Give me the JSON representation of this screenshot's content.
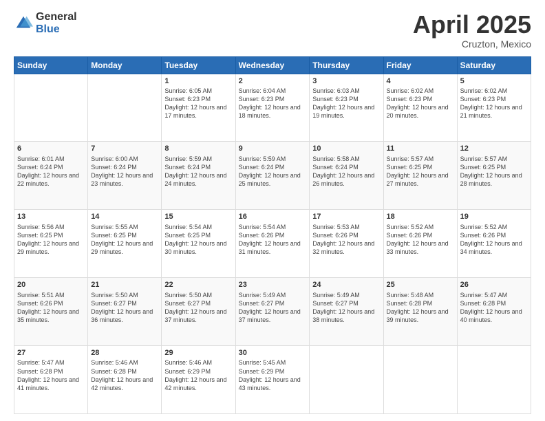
{
  "header": {
    "logo_general": "General",
    "logo_blue": "Blue",
    "title": "April 2025",
    "location": "Cruzton, Mexico"
  },
  "weekdays": [
    "Sunday",
    "Monday",
    "Tuesday",
    "Wednesday",
    "Thursday",
    "Friday",
    "Saturday"
  ],
  "weeks": [
    [
      {
        "day": "",
        "info": ""
      },
      {
        "day": "",
        "info": ""
      },
      {
        "day": "1",
        "info": "Sunrise: 6:05 AM\nSunset: 6:23 PM\nDaylight: 12 hours and 17 minutes."
      },
      {
        "day": "2",
        "info": "Sunrise: 6:04 AM\nSunset: 6:23 PM\nDaylight: 12 hours and 18 minutes."
      },
      {
        "day": "3",
        "info": "Sunrise: 6:03 AM\nSunset: 6:23 PM\nDaylight: 12 hours and 19 minutes."
      },
      {
        "day": "4",
        "info": "Sunrise: 6:02 AM\nSunset: 6:23 PM\nDaylight: 12 hours and 20 minutes."
      },
      {
        "day": "5",
        "info": "Sunrise: 6:02 AM\nSunset: 6:23 PM\nDaylight: 12 hours and 21 minutes."
      }
    ],
    [
      {
        "day": "6",
        "info": "Sunrise: 6:01 AM\nSunset: 6:24 PM\nDaylight: 12 hours and 22 minutes."
      },
      {
        "day": "7",
        "info": "Sunrise: 6:00 AM\nSunset: 6:24 PM\nDaylight: 12 hours and 23 minutes."
      },
      {
        "day": "8",
        "info": "Sunrise: 5:59 AM\nSunset: 6:24 PM\nDaylight: 12 hours and 24 minutes."
      },
      {
        "day": "9",
        "info": "Sunrise: 5:59 AM\nSunset: 6:24 PM\nDaylight: 12 hours and 25 minutes."
      },
      {
        "day": "10",
        "info": "Sunrise: 5:58 AM\nSunset: 6:24 PM\nDaylight: 12 hours and 26 minutes."
      },
      {
        "day": "11",
        "info": "Sunrise: 5:57 AM\nSunset: 6:25 PM\nDaylight: 12 hours and 27 minutes."
      },
      {
        "day": "12",
        "info": "Sunrise: 5:57 AM\nSunset: 6:25 PM\nDaylight: 12 hours and 28 minutes."
      }
    ],
    [
      {
        "day": "13",
        "info": "Sunrise: 5:56 AM\nSunset: 6:25 PM\nDaylight: 12 hours and 29 minutes."
      },
      {
        "day": "14",
        "info": "Sunrise: 5:55 AM\nSunset: 6:25 PM\nDaylight: 12 hours and 29 minutes."
      },
      {
        "day": "15",
        "info": "Sunrise: 5:54 AM\nSunset: 6:25 PM\nDaylight: 12 hours and 30 minutes."
      },
      {
        "day": "16",
        "info": "Sunrise: 5:54 AM\nSunset: 6:26 PM\nDaylight: 12 hours and 31 minutes."
      },
      {
        "day": "17",
        "info": "Sunrise: 5:53 AM\nSunset: 6:26 PM\nDaylight: 12 hours and 32 minutes."
      },
      {
        "day": "18",
        "info": "Sunrise: 5:52 AM\nSunset: 6:26 PM\nDaylight: 12 hours and 33 minutes."
      },
      {
        "day": "19",
        "info": "Sunrise: 5:52 AM\nSunset: 6:26 PM\nDaylight: 12 hours and 34 minutes."
      }
    ],
    [
      {
        "day": "20",
        "info": "Sunrise: 5:51 AM\nSunset: 6:26 PM\nDaylight: 12 hours and 35 minutes."
      },
      {
        "day": "21",
        "info": "Sunrise: 5:50 AM\nSunset: 6:27 PM\nDaylight: 12 hours and 36 minutes."
      },
      {
        "day": "22",
        "info": "Sunrise: 5:50 AM\nSunset: 6:27 PM\nDaylight: 12 hours and 37 minutes."
      },
      {
        "day": "23",
        "info": "Sunrise: 5:49 AM\nSunset: 6:27 PM\nDaylight: 12 hours and 37 minutes."
      },
      {
        "day": "24",
        "info": "Sunrise: 5:49 AM\nSunset: 6:27 PM\nDaylight: 12 hours and 38 minutes."
      },
      {
        "day": "25",
        "info": "Sunrise: 5:48 AM\nSunset: 6:28 PM\nDaylight: 12 hours and 39 minutes."
      },
      {
        "day": "26",
        "info": "Sunrise: 5:47 AM\nSunset: 6:28 PM\nDaylight: 12 hours and 40 minutes."
      }
    ],
    [
      {
        "day": "27",
        "info": "Sunrise: 5:47 AM\nSunset: 6:28 PM\nDaylight: 12 hours and 41 minutes."
      },
      {
        "day": "28",
        "info": "Sunrise: 5:46 AM\nSunset: 6:28 PM\nDaylight: 12 hours and 42 minutes."
      },
      {
        "day": "29",
        "info": "Sunrise: 5:46 AM\nSunset: 6:29 PM\nDaylight: 12 hours and 42 minutes."
      },
      {
        "day": "30",
        "info": "Sunrise: 5:45 AM\nSunset: 6:29 PM\nDaylight: 12 hours and 43 minutes."
      },
      {
        "day": "",
        "info": ""
      },
      {
        "day": "",
        "info": ""
      },
      {
        "day": "",
        "info": ""
      }
    ]
  ]
}
